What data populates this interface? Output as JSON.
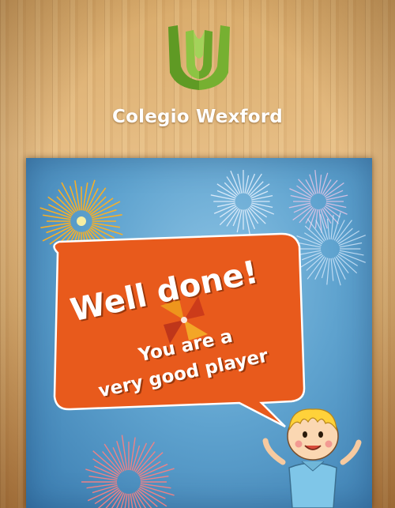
{
  "header": {
    "school_name": "Colegio Wexford",
    "logo_icon": "colegio-wexford-logo",
    "logo_color": "#6aa52a"
  },
  "message": {
    "title": "Well done!",
    "line1": "You are a",
    "line2": "very good player",
    "bubble_color": "#e85a1c"
  },
  "scene": {
    "background_color": "#5fa3cf",
    "decorations": [
      "fireworks-icon",
      "pinwheel-icon",
      "cartoon-boy-icon"
    ]
  }
}
